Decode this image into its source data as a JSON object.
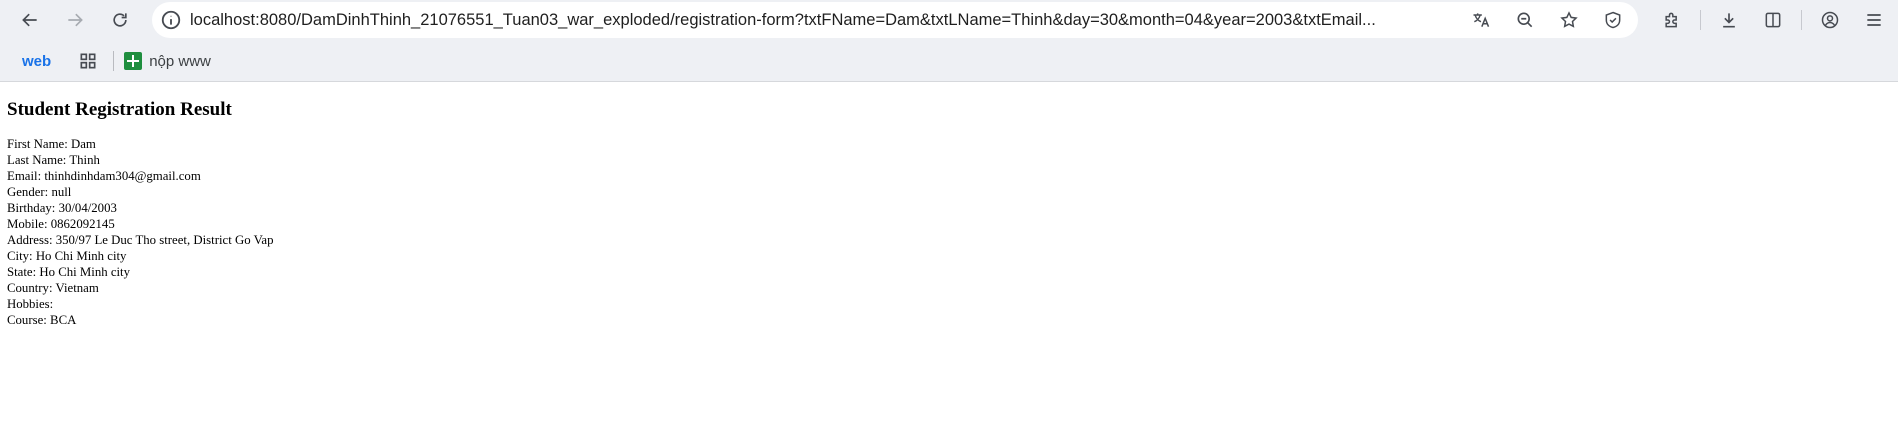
{
  "browser": {
    "url": "localhost:8080/DamDinhThinh_21076551_Tuan03_war_exploded/registration-form?txtFName=Dam&txtLName=Thinh&day=30&month=04&year=2003&txtEmail...",
    "bookmarks": {
      "web_label": "web",
      "items": [
        {
          "label": "nộp www",
          "icon": "google-sheets-icon"
        }
      ]
    },
    "icons": [
      "back-icon",
      "forward-icon",
      "reload-icon",
      "site-info-icon",
      "translate-icon",
      "zoom-out-icon",
      "bookmark-star-icon",
      "shield-icon",
      "extensions-icon",
      "download-icon",
      "side-panel-icon",
      "profile-icon",
      "menu-icon"
    ]
  },
  "page": {
    "heading": "Student Registration Result",
    "fields": [
      {
        "label": "First Name",
        "value": "Dam"
      },
      {
        "label": "Last Name",
        "value": "Thinh"
      },
      {
        "label": "Email",
        "value": "thinhdinhdam304@gmail.com"
      },
      {
        "label": "Gender",
        "value": "null"
      },
      {
        "label": "Birthday",
        "value": "30/04/2003"
      },
      {
        "label": "Mobile",
        "value": "0862092145"
      },
      {
        "label": "Address",
        "value": "350/97 Le Duc Tho street, District Go Vap"
      },
      {
        "label": "City",
        "value": "Ho Chi Minh city"
      },
      {
        "label": "State",
        "value": "Ho Chi Minh city"
      },
      {
        "label": "Country",
        "value": "Vietnam"
      },
      {
        "label": "Hobbies",
        "value": ""
      },
      {
        "label": "Course",
        "value": "BCA"
      }
    ]
  }
}
